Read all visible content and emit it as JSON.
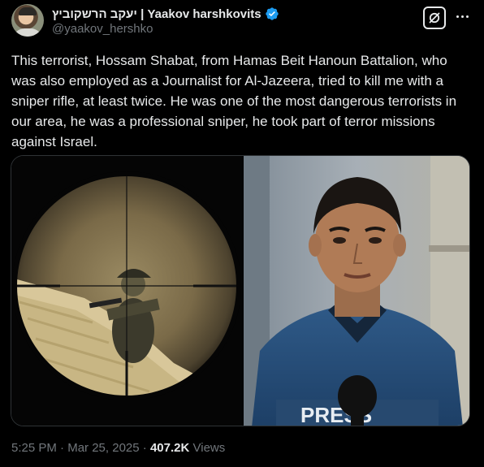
{
  "author": {
    "display_name": "יעקב הרשקוביץ | Yaakov harshkovits",
    "handle": "@yaakov_hershko",
    "verified_color": "#1d9bf0"
  },
  "header": {
    "grok_icon": "grok-slash-icon",
    "more_icon": "more-dots-icon"
  },
  "tweet": {
    "text": "This terrorist, Hossam Shabat, from Hamas Beit Hanoun Battalion, who was also employed as a Journalist for Al-Jazeera, tried to kill me with a sniper rifle, at least twice. He was one of the most dangerous terrorists in our area, he was a professional sniper, he took part of terror missions against Israel."
  },
  "media": {
    "left_image": "sniper-scope-view",
    "right_image": "portrait-in-blue-vest",
    "vest_text": "PRESS"
  },
  "meta": {
    "time": "5:25 PM",
    "date": "Mar 25, 2025",
    "separator": "·",
    "views_count": "407.2K",
    "views_label": "Views"
  }
}
